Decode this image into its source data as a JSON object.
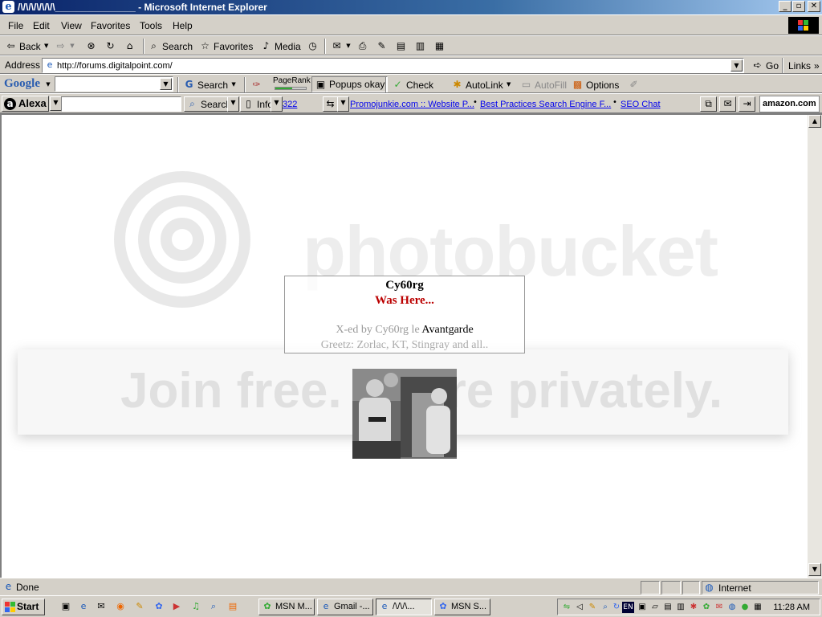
{
  "window": {
    "title": "/\\/\\/\\/\\/\\/\\/\\_______________ - Microsoft Internet Explorer",
    "controls": [
      "_",
      "▫",
      "✕"
    ]
  },
  "menu": [
    "File",
    "Edit",
    "View",
    "Favorites",
    "Tools",
    "Help"
  ],
  "toolbar": {
    "back": "Back",
    "search": "Search",
    "favorites": "Favorites",
    "media": "Media"
  },
  "address": {
    "label": "Address",
    "url": "http://forums.digitalpoint.com/",
    "go": "Go",
    "links": "Links"
  },
  "google": {
    "logo": "Google",
    "search": "Search",
    "pagerank": "PageRank",
    "popups": "Popups okay",
    "check": "Check",
    "autolink": "AutoLink",
    "autofill": "AutoFill",
    "options": "Options"
  },
  "alexa": {
    "logo": "Alexa",
    "search": "Search",
    "info": "Info",
    "count": "322",
    "links": [
      "Promojunkie.com :: Website P...",
      "Best Practices Search Engine F...",
      "SEO Chat"
    ],
    "amazon": "amazon.com"
  },
  "page": {
    "watermark_logo": "photobucket",
    "watermark_tagline": "Join free. Share privately.",
    "line1": "Cy60rg",
    "line2": "Was Here...",
    "line3_prefix": "X-ed by Cy60rg le",
    "line3_name": "Avantgarde",
    "line4": "Greetz: Zorlac, KT, Stingray and all.."
  },
  "status": {
    "text": "Done",
    "zone": "Internet"
  },
  "taskbar": {
    "start": "Start",
    "tasks": [
      "MSN M...",
      "Gmail -...",
      "/\\/\\/\\...",
      "MSN S..."
    ],
    "lang": "EN",
    "clock": "11:28 AM"
  },
  "colors": {
    "title_bar": "#0a246a",
    "deface_red": "#b00000",
    "link": "#0000ee"
  }
}
